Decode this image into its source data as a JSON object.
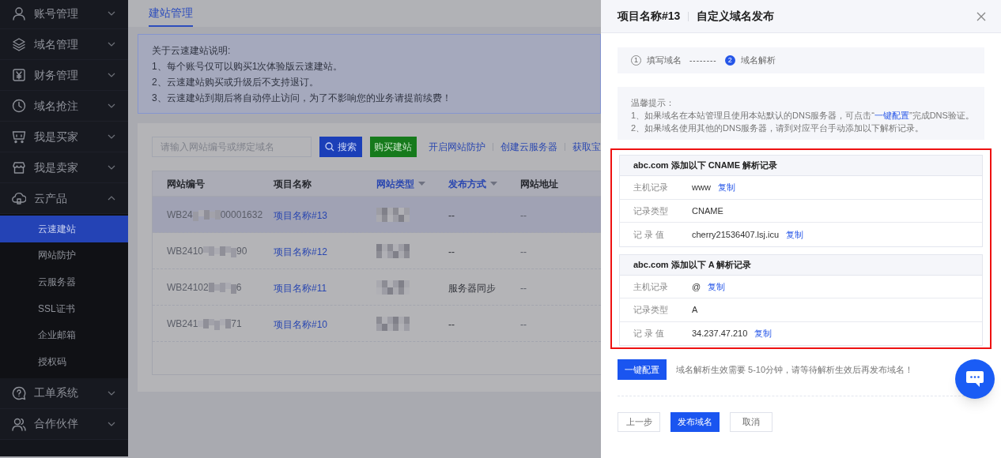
{
  "sidebar": {
    "items": [
      {
        "label": "账号管理",
        "expanded": false
      },
      {
        "label": "域名管理",
        "expanded": false
      },
      {
        "label": "财务管理",
        "expanded": false
      },
      {
        "label": "域名抢注",
        "expanded": false
      },
      {
        "label": "我是买家",
        "expanded": false
      },
      {
        "label": "我是卖家",
        "expanded": false
      },
      {
        "label": "云产品",
        "expanded": true,
        "children": [
          {
            "label": "云速建站",
            "selected": true
          },
          {
            "label": "网站防护",
            "selected": false
          },
          {
            "label": "云服务器",
            "selected": false
          },
          {
            "label": "SSL证书",
            "selected": false
          },
          {
            "label": "企业邮箱",
            "selected": false
          },
          {
            "label": "授权码",
            "selected": false
          }
        ]
      },
      {
        "label": "工单系统",
        "expanded": false
      },
      {
        "label": "合作伙伴",
        "expanded": false
      }
    ]
  },
  "main": {
    "tabs": [
      {
        "label": "建站管理",
        "selected": true
      }
    ],
    "notice": {
      "title": "关于云速建站说明:",
      "lines": [
        "1、每个账号仅可以购买1次体验版云速建站。",
        "2、云速建站购买或升级后不支持退订。",
        "3、云速建站到期后将自动停止访问，为了不影响您的业务请提前续费！"
      ]
    },
    "search": {
      "placeholder": "请输入网站编号或绑定域名"
    },
    "search_button": "搜索",
    "buy_button": "购买建站",
    "links": [
      "开启网站防护",
      "创建云服务器",
      "获取宝"
    ],
    "table": {
      "columns": [
        {
          "label": "网站编号",
          "sortable": false
        },
        {
          "label": "项目名称",
          "sortable": false
        },
        {
          "label": "网站类型",
          "sortable": true
        },
        {
          "label": "发布方式",
          "sortable": true
        },
        {
          "label": "网站地址",
          "sortable": false
        }
      ],
      "rows": [
        {
          "id_start": "WB24",
          "id_end": "00001632",
          "name": "项目名称#13",
          "publish": "--",
          "address": "--",
          "highlighted": true
        },
        {
          "id_start": "WB2410",
          "id_end": "90",
          "name": "项目名称#12",
          "publish": "--",
          "address": "--",
          "highlighted": false
        },
        {
          "id_start": "WB24102",
          "id_end": "6",
          "name": "项目名称#11",
          "publish": "服务器同步",
          "address": "--",
          "highlighted": false
        },
        {
          "id_start": "WB241",
          "id_end": "71",
          "name": "项目名称#10",
          "publish": "--",
          "address": "--",
          "highlighted": false
        }
      ]
    }
  },
  "drawer": {
    "title": "项目名称#13",
    "subtitle": "自定义域名发布",
    "steps": [
      {
        "number": "1",
        "label": "填写域名",
        "active": false
      },
      {
        "number": "2",
        "label": "域名解析",
        "active": true
      }
    ],
    "step_separator": "--------",
    "tips": {
      "title": "温馨提示：",
      "lines": [
        {
          "before": "1、如果域名在本站管理且使用本站默认的DNS服务器，可点击“",
          "link": "一键配置",
          "after": "”完成DNS验证。"
        },
        {
          "before": "2、如果域名使用其他的DNS服务器，请到对应平台手动添加以下解析记录。"
        }
      ]
    },
    "highlighted": true,
    "records": [
      {
        "title": "abc.com 添加以下 CNAME 解析记录",
        "rows": [
          {
            "label": "主机记录",
            "value": "www",
            "copy": "复制"
          },
          {
            "label": "记录类型",
            "value": "CNAME"
          },
          {
            "label": "记 录 值",
            "value": "cherry21536407.lsj.icu",
            "copy": "复制"
          }
        ]
      },
      {
        "title": "abc.com 添加以下 A 解析记录",
        "rows": [
          {
            "label": "主机记录",
            "value": "@",
            "copy": "复制"
          },
          {
            "label": "记录类型",
            "value": "A"
          },
          {
            "label": "记 录 值",
            "value": "34.237.47.210",
            "copy": "复制"
          }
        ]
      }
    ],
    "config_button": "一键配置",
    "config_note": "域名解析生效需要 5-10分钟，请等待解析生效后再发布域名！",
    "buttons": [
      {
        "label": "上一步",
        "kind": "default"
      },
      {
        "label": "发布域名",
        "kind": "primary"
      },
      {
        "label": "取消",
        "kind": "default"
      }
    ]
  }
}
